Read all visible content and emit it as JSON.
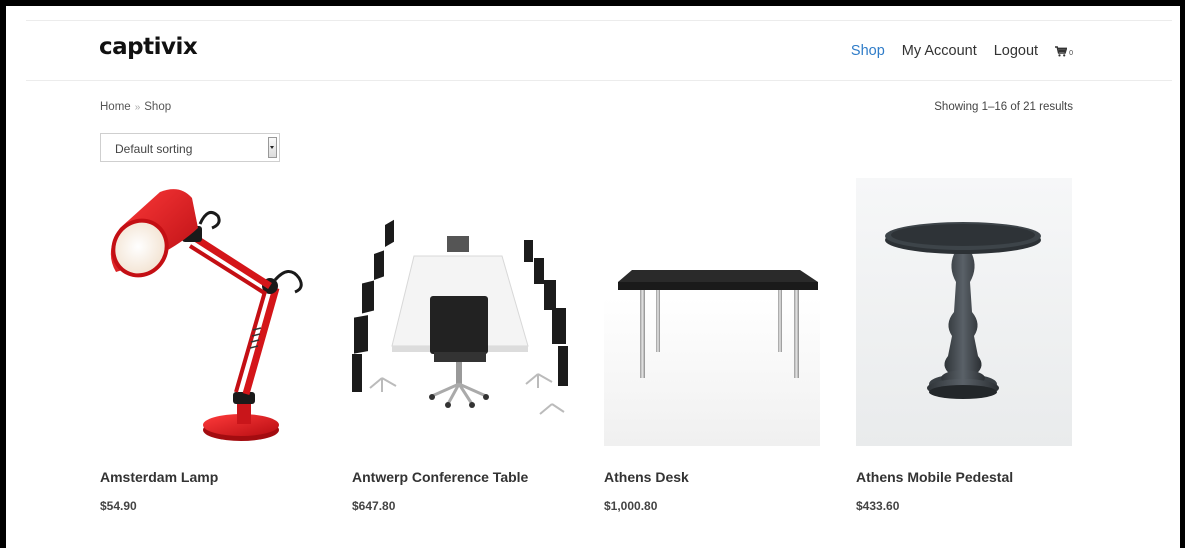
{
  "brand": {
    "logo_text": "captivix",
    "accent": "#6ac17a"
  },
  "nav": {
    "items": [
      {
        "label": "Shop",
        "active": true
      },
      {
        "label": "My Account"
      },
      {
        "label": "Logout"
      }
    ],
    "cart_count": "0",
    "cart_icon": "cart-icon",
    "active_color": "#2f7cc8"
  },
  "breadcrumb": {
    "home": "Home",
    "separator": "»",
    "current": "Shop"
  },
  "results": {
    "text": "Showing 1–16 of 21 results"
  },
  "sorting": {
    "selected": "Default sorting"
  },
  "products": [
    {
      "name": "Amsterdam Lamp",
      "price": "$54.90",
      "image": "desk-lamp-image"
    },
    {
      "name": "Antwerp Conference Table",
      "price": "$647.80",
      "image": "conference-table-image"
    },
    {
      "name": "Athens Desk",
      "price": "$1,000.80",
      "image": "desk-image"
    },
    {
      "name": "Athens Mobile Pedestal",
      "price": "$433.60",
      "image": "pedestal-image"
    }
  ]
}
